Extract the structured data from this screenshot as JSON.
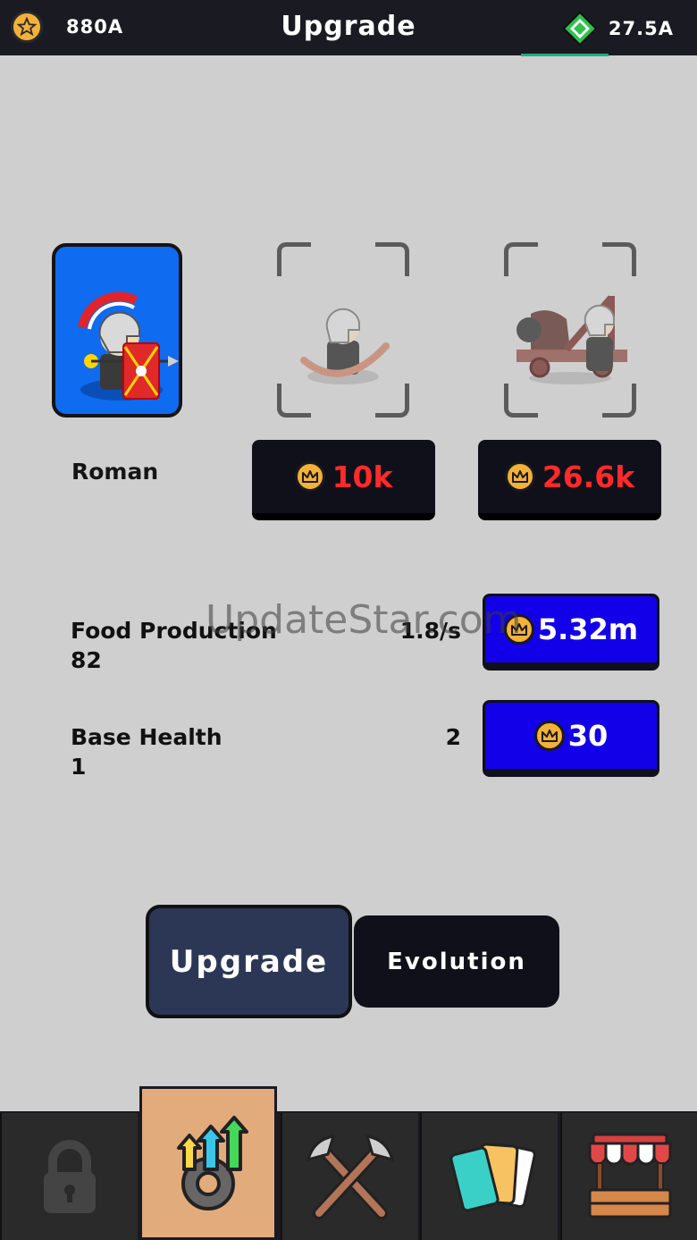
{
  "header": {
    "currency_left": "880A",
    "title": "Upgrade",
    "currency_right": "27.5A"
  },
  "units": [
    {
      "name": "Roman",
      "unlocked": true
    },
    {
      "name": "",
      "price": "10k",
      "unlocked": false
    },
    {
      "name": "",
      "price": "26.6k",
      "unlocked": false
    }
  ],
  "stats": [
    {
      "label": "Food Production",
      "level": "82",
      "value": "1.8/s",
      "cost": "5.32m"
    },
    {
      "label": "Base Health",
      "level": "1",
      "value": "2",
      "cost": "30"
    }
  ],
  "tabs": {
    "upgrade": "Upgrade",
    "evolution": "Evolution"
  },
  "watermark": "UpdateStar.com",
  "nav": [
    "lock-icon",
    "upgrade-icon",
    "battle-icon",
    "cards-icon",
    "shop-icon"
  ],
  "colors": {
    "accent_blue": "#1200e8",
    "price_red": "#ff2a2a",
    "gold": "#f3b13a",
    "nav_active": "#e2ab7c"
  }
}
